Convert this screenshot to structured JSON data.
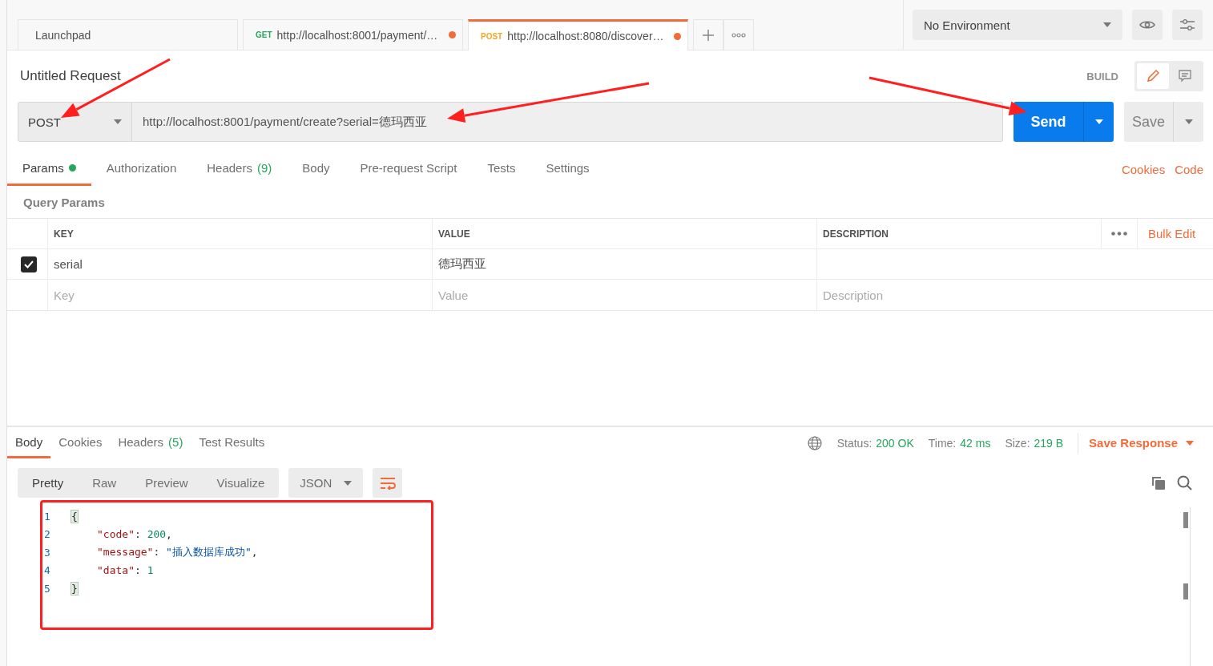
{
  "tabs": [
    {
      "kind": "launchpad",
      "label": "Launchpad",
      "selected": false,
      "unsaved": false
    },
    {
      "kind": "request",
      "method": "GET",
      "url": "http://localhost:8001/payment/…",
      "selected": false,
      "unsaved": true
    },
    {
      "kind": "request",
      "method": "POST",
      "url": "http://localhost:8080/discover…",
      "selected": true,
      "unsaved": true
    }
  ],
  "environment": {
    "value": "No Environment"
  },
  "mode_toggle": [
    {
      "kind": "build",
      "selected": true
    },
    {
      "kind": "comments",
      "selected": false
    }
  ],
  "request": {
    "title": "Untitled Request",
    "mode": "BUILD",
    "method": "POST",
    "url": "http://localhost:8001/payment/create?serial=德玛西亚",
    "send": "Send",
    "save": "Save"
  },
  "request_tabs": [
    {
      "label": "Params",
      "dot": true,
      "selected": true
    },
    {
      "label": "Authorization",
      "dot": false,
      "selected": false
    },
    {
      "label": "Headers",
      "count": "(9)",
      "dot": false,
      "selected": false
    },
    {
      "label": "Body",
      "dot": false,
      "selected": false
    },
    {
      "label": "Pre-request Script",
      "dot": false,
      "selected": false
    },
    {
      "label": "Tests",
      "dot": false,
      "selected": false
    },
    {
      "label": "Settings",
      "dot": false,
      "selected": false
    }
  ],
  "request_links": [
    "Cookies",
    "Code"
  ],
  "query_params": {
    "title": "Query Params",
    "columns": [
      "KEY",
      "VALUE",
      "DESCRIPTION"
    ],
    "bulk_edit": "Bulk Edit",
    "rows": [
      {
        "checked": true,
        "key": "serial",
        "value": "德玛西亚"
      }
    ],
    "new_row": {
      "key": {
        "placeholder": "Key"
      },
      "value": {
        "placeholder": "Value"
      },
      "description": {
        "placeholder": "Description"
      }
    }
  },
  "response_tabs": [
    {
      "label": "Body",
      "selected": true
    },
    {
      "label": "Cookies",
      "selected": false
    },
    {
      "label": "Headers",
      "count": "(5)",
      "selected": false
    },
    {
      "label": "Test Results",
      "selected": false
    }
  ],
  "response_meta": {
    "status_label": "Status:",
    "status": "200 OK",
    "time_label": "Time:",
    "time": "42 ms",
    "size_label": "Size:",
    "size": "219 B",
    "save": "Save Response"
  },
  "view_modes": [
    {
      "label": "Pretty",
      "selected": true
    },
    {
      "label": "Raw",
      "selected": false
    },
    {
      "label": "Preview",
      "selected": false
    },
    {
      "label": "Visualize",
      "selected": false
    }
  ],
  "format": "JSON",
  "code_lines": [
    {
      "number": "1",
      "indented": false,
      "tokens": [
        {
          "kind": "bracket",
          "text": "{"
        }
      ]
    },
    {
      "number": "2",
      "indented": true,
      "tokens": [
        {
          "kind": "key",
          "text": "\"code\""
        },
        {
          "kind": "punct",
          "text": ": "
        },
        {
          "kind": "number",
          "text": "200"
        },
        {
          "kind": "punct",
          "text": ","
        }
      ]
    },
    {
      "number": "3",
      "indented": true,
      "tokens": [
        {
          "kind": "key",
          "text": "\"message\""
        },
        {
          "kind": "punct",
          "text": ": "
        },
        {
          "kind": "string",
          "text": "\"插入数据库成功\""
        },
        {
          "kind": "punct",
          "text": ","
        }
      ]
    },
    {
      "number": "4",
      "indented": true,
      "tokens": [
        {
          "kind": "key",
          "text": "\"data\""
        },
        {
          "kind": "punct",
          "text": ": "
        },
        {
          "kind": "number",
          "text": "1"
        }
      ]
    },
    {
      "number": "5",
      "indented": false,
      "tokens": [
        {
          "kind": "bracket",
          "text": "}"
        }
      ]
    }
  ]
}
